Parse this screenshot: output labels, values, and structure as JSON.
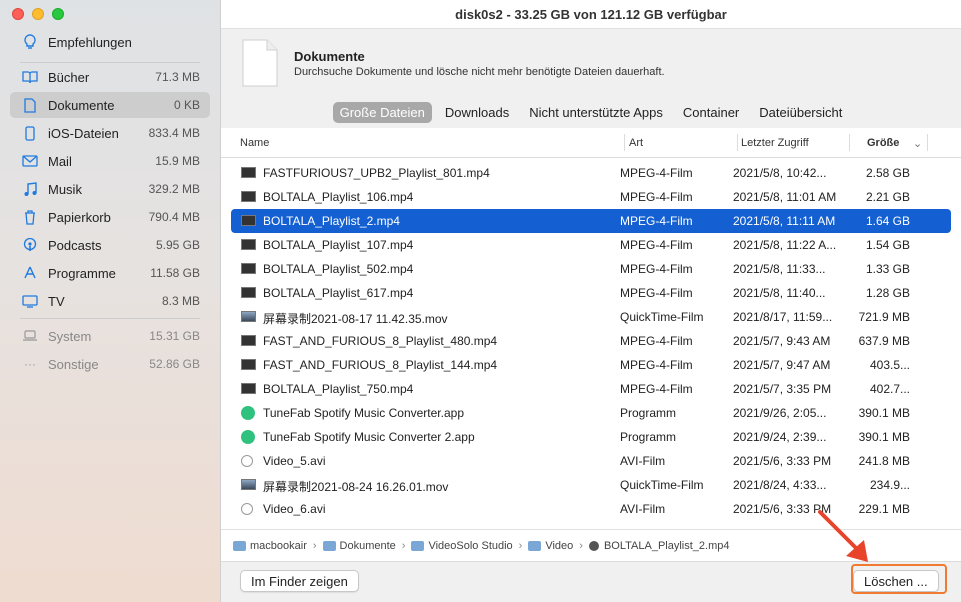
{
  "window": {
    "title": "disk0s2 - 33.25 GB von 121.12 GB verfügbar"
  },
  "sidebar": {
    "items": [
      {
        "label": "Empfehlungen",
        "size": "",
        "icon": "lightbulb-icon"
      },
      {
        "label": "Bücher",
        "size": "71.3 MB",
        "icon": "book-icon"
      },
      {
        "label": "Dokumente",
        "size": "0 KB",
        "icon": "document-icon"
      },
      {
        "label": "iOS-Dateien",
        "size": "833.4 MB",
        "icon": "phone-icon"
      },
      {
        "label": "Mail",
        "size": "15.9 MB",
        "icon": "mail-icon"
      },
      {
        "label": "Musik",
        "size": "329.2 MB",
        "icon": "music-icon"
      },
      {
        "label": "Papierkorb",
        "size": "790.4 MB",
        "icon": "trash-icon"
      },
      {
        "label": "Podcasts",
        "size": "5.95 GB",
        "icon": "podcast-icon"
      },
      {
        "label": "Programme",
        "size": "11.58 GB",
        "icon": "apps-icon"
      },
      {
        "label": "TV",
        "size": "8.3 MB",
        "icon": "tv-icon"
      },
      {
        "label": "System",
        "size": "15.31 GB",
        "icon": "laptop-icon"
      },
      {
        "label": "Sonstige",
        "size": "52.86 GB",
        "icon": "ellipsis-icon"
      }
    ]
  },
  "section": {
    "title": "Dokumente",
    "description": "Durchsuche Dokumente und lösche nicht mehr benötigte Dateien dauerhaft."
  },
  "tabs": [
    "Große Dateien",
    "Downloads",
    "Nicht unterstützte Apps",
    "Container",
    "Dateiübersicht"
  ],
  "columns": {
    "name": "Name",
    "art": "Art",
    "date": "Letzter Zugriff",
    "size": "Größe"
  },
  "rows": [
    {
      "name": "FASTFURIOUS7_UPB2_Playlist_801.mp4",
      "art": "MPEG-4-Film",
      "date": "2021/5/8, 10:42...",
      "size": "2.58 GB",
      "type": "mp4"
    },
    {
      "name": "BOLTALA_Playlist_106.mp4",
      "art": "MPEG-4-Film",
      "date": "2021/5/8, 11:01 AM",
      "size": "2.21 GB",
      "type": "mp4"
    },
    {
      "name": "BOLTALA_Playlist_2.mp4",
      "art": "MPEG-4-Film",
      "date": "2021/5/8, 11:11 AM",
      "size": "1.64 GB",
      "type": "mp4"
    },
    {
      "name": "BOLTALA_Playlist_107.mp4",
      "art": "MPEG-4-Film",
      "date": "2021/5/8, 11:22 A...",
      "size": "1.54 GB",
      "type": "mp4"
    },
    {
      "name": "BOLTALA_Playlist_502.mp4",
      "art": "MPEG-4-Film",
      "date": "2021/5/8, 11:33...",
      "size": "1.33 GB",
      "type": "mp4"
    },
    {
      "name": "BOLTALA_Playlist_617.mp4",
      "art": "MPEG-4-Film",
      "date": "2021/5/8, 11:40...",
      "size": "1.28 GB",
      "type": "mp4"
    },
    {
      "name": "屏幕录制2021-08-17 11.42.35.mov",
      "art": "QuickTime-Film",
      "date": "2021/8/17, 11:59...",
      "size": "721.9 MB",
      "type": "mov"
    },
    {
      "name": "FAST_AND_FURIOUS_8_Playlist_480.mp4",
      "art": "MPEG-4-Film",
      "date": "2021/5/7, 9:43 AM",
      "size": "637.9 MB",
      "type": "mp4"
    },
    {
      "name": "FAST_AND_FURIOUS_8_Playlist_144.mp4",
      "art": "MPEG-4-Film",
      "date": "2021/5/7, 9:47 AM",
      "size": "403.5...",
      "type": "mp4"
    },
    {
      "name": "BOLTALA_Playlist_750.mp4",
      "art": "MPEG-4-Film",
      "date": "2021/5/7, 3:35 PM",
      "size": "402.7...",
      "type": "mp4"
    },
    {
      "name": "TuneFab Spotify Music Converter.app",
      "art": "Programm",
      "date": "2021/9/26, 2:05...",
      "size": "390.1 MB",
      "type": "app"
    },
    {
      "name": "TuneFab Spotify Music Converter 2.app",
      "art": "Programm",
      "date": "2021/9/24, 2:39...",
      "size": "390.1 MB",
      "type": "app"
    },
    {
      "name": "Video_5.avi",
      "art": "AVI-Film",
      "date": "2021/5/6, 3:33 PM",
      "size": "241.8 MB",
      "type": "avi"
    },
    {
      "name": "屏幕录制2021-08-24 16.26.01.mov",
      "art": "QuickTime-Film",
      "date": "2021/8/24, 4:33...",
      "size": "234.9...",
      "type": "mov"
    },
    {
      "name": "Video_6.avi",
      "art": "AVI-Film",
      "date": "2021/5/6, 3:33 PM",
      "size": "229.1 MB",
      "type": "avi"
    }
  ],
  "selected_row": 2,
  "breadcrumb": [
    "macbookair",
    "Dokumente",
    "VideoSolo Studio",
    "Video",
    "BOLTALA_Playlist_2.mp4"
  ],
  "footer": {
    "finder_label": "Im Finder zeigen",
    "delete_label": "Löschen ..."
  },
  "colors": {
    "accent": "#1460d2",
    "highlight": "#f07a30"
  }
}
